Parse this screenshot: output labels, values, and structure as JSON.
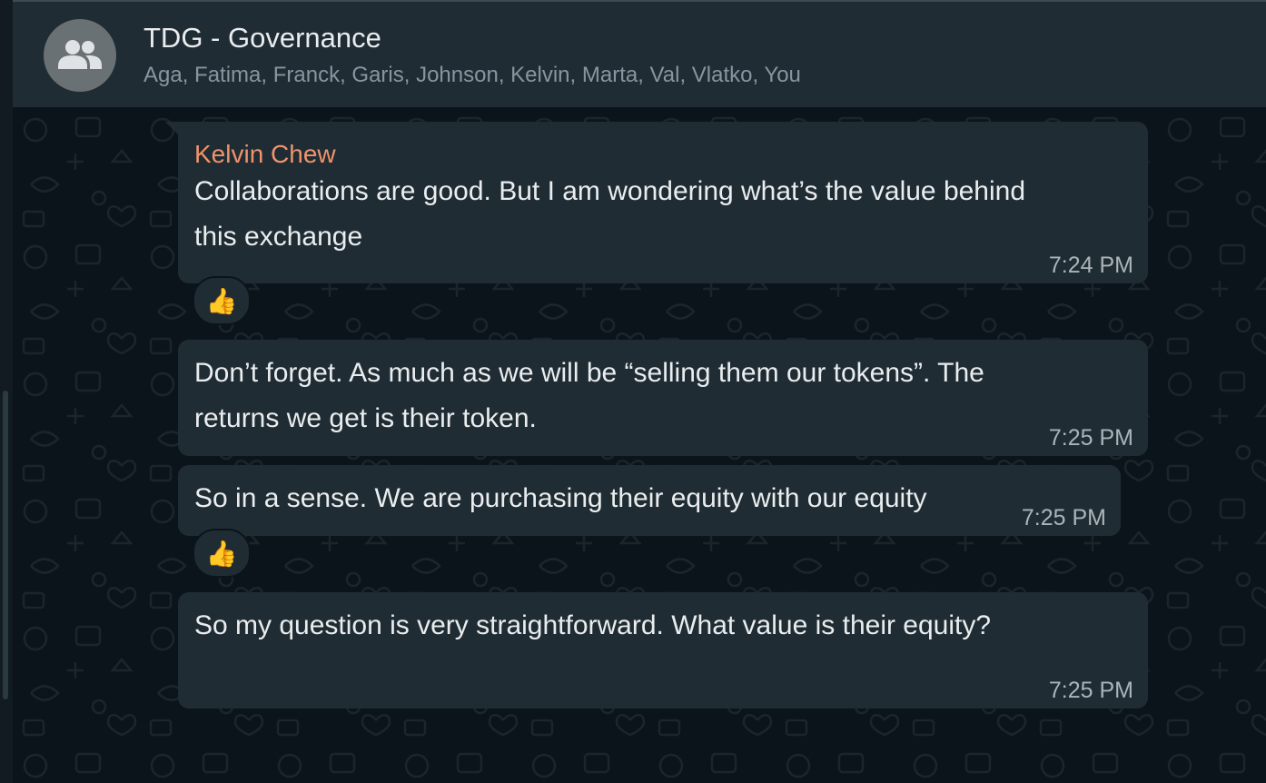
{
  "header": {
    "title": "TDG - Governance",
    "members": "Aga, Fatima, Franck, Garis, Johnson, Kelvin, Marta, Val, Vlatko, You",
    "avatar_icon": "group-icon"
  },
  "messages": [
    {
      "sender": "Kelvin Chew",
      "lines": [
        "Collaborations are good. But I am wondering what’s the value behind",
        "this exchange"
      ],
      "time": "7:24 PM",
      "reaction": "👍"
    },
    {
      "lines": [
        "Don’t forget. As much as we will be “selling them our tokens”. The",
        "returns we get is their token."
      ],
      "time": "7:25 PM"
    },
    {
      "lines": [
        "So in a sense. We are purchasing their equity with our equity"
      ],
      "time": "7:25 PM",
      "reaction": "👍"
    },
    {
      "lines": [
        "So my question is very straightforward. What value is their equity?"
      ],
      "time": "7:25 PM"
    }
  ],
  "colors": {
    "background": "#0b141a",
    "bubble": "#202c33",
    "sender_name": "#f0936b",
    "timestamp": "#aab4ba"
  }
}
